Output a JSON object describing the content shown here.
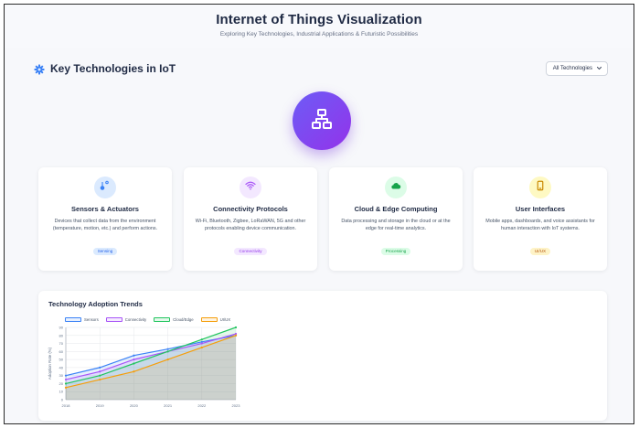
{
  "header": {
    "title": "Internet of Things Visualization",
    "subtitle": "Exploring Key Technologies, Industrial Applications & Futuristic Possibilities"
  },
  "section": {
    "title": "Key Technologies in IoT",
    "icon": "gear-icon",
    "filter_selected": "All Technologies"
  },
  "hub": {
    "icon": "network-hub-icon"
  },
  "cards": [
    {
      "icon": "sensor-icon",
      "title": "Sensors & Actuators",
      "description": "Devices that collect data from the environment (temperature, motion, etc.) and perform actions.",
      "badge": "Sensing",
      "accent": "#3b82f6",
      "icon_bg": "#dbeafe",
      "badge_bg": "#dbeafe",
      "badge_color": "#2563eb"
    },
    {
      "icon": "wifi-icon",
      "title": "Connectivity Protocols",
      "description": "Wi-Fi, Bluetooth, Zigbee, LoRaWAN, 5G and other protocols enabling device communication.",
      "badge": "Connectivity",
      "accent": "#a855f7",
      "icon_bg": "#f3e8ff",
      "badge_bg": "#f3e8ff",
      "badge_color": "#9333ea"
    },
    {
      "icon": "cloud-icon",
      "title": "Cloud & Edge Computing",
      "description": "Data processing and storage in the cloud or at the edge for real-time analytics.",
      "badge": "Processing",
      "accent": "#22c55e",
      "icon_bg": "#dcfce7",
      "badge_bg": "#dcfce7",
      "badge_color": "#16a34a"
    },
    {
      "icon": "smartphone-icon",
      "title": "User Interfaces",
      "description": "Mobile apps, dashboards, and voice assistants for human interaction with IoT systems.",
      "badge": "UI/UX",
      "accent": "#eab308",
      "icon_bg": "#fef9c3",
      "badge_bg": "#fef3c7",
      "badge_color": "#b45309"
    }
  ],
  "chart_section": {
    "title": "Technology Adoption Trends"
  },
  "chart_data": {
    "type": "line",
    "x": [
      "2018",
      "2019",
      "2020",
      "2021",
      "2022",
      "2023"
    ],
    "ylabel": "Adoption Rate (%)",
    "ylim": [
      0,
      90
    ],
    "yticks": [
      0,
      10,
      20,
      30,
      40,
      50,
      60,
      70,
      80,
      90
    ],
    "grid": true,
    "legend": "top-left",
    "series": [
      {
        "name": "Sensors",
        "values": [
          30,
          40,
          55,
          63,
          72,
          80
        ],
        "color": "#3b82f6",
        "fill": "rgba(59,130,246,0.12)"
      },
      {
        "name": "Connectivity",
        "values": [
          25,
          35,
          50,
          60,
          70,
          82
        ],
        "color": "#a855f7",
        "fill": "rgba(168,85,247,0.12)"
      },
      {
        "name": "Cloud/Edge",
        "values": [
          20,
          30,
          45,
          60,
          75,
          90
        ],
        "color": "#22c55e",
        "fill": "rgba(34,197,94,0.12)"
      },
      {
        "name": "UI/UX",
        "values": [
          15,
          25,
          35,
          50,
          65,
          80
        ],
        "color": "#f59e0b",
        "fill": "rgba(245,158,11,0.12)"
      }
    ]
  }
}
